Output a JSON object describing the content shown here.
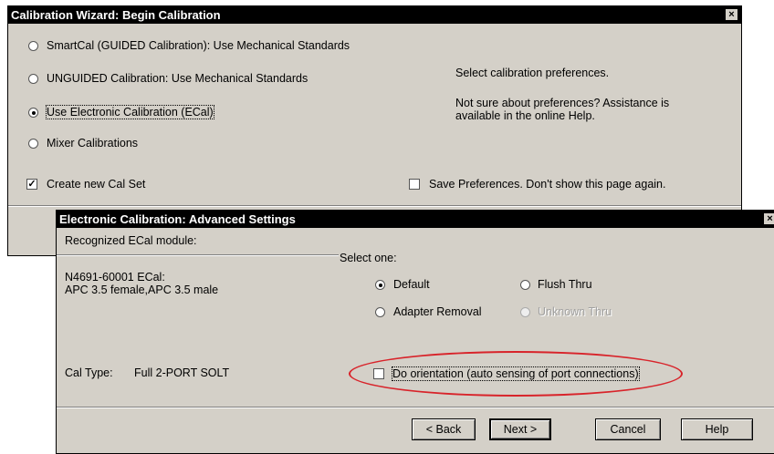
{
  "wizard": {
    "title": "Calibration Wizard: Begin Calibration",
    "close_glyph": "×",
    "options": [
      {
        "label": "SmartCal (GUIDED Calibration): Use Mechanical Standards",
        "selected": false
      },
      {
        "label": "UNGUIDED Calibration: Use Mechanical Standards",
        "selected": false
      },
      {
        "label": "Use Electronic Calibration (ECal)",
        "selected": true
      },
      {
        "label": "Mixer Calibrations",
        "selected": false
      }
    ],
    "info_text": "Select calibration preferences.",
    "help_line1": "Not sure about preferences?  Assistance is",
    "help_line2": "available in the online Help.",
    "create_cal_set": {
      "label": "Create new Cal Set",
      "checked": true
    },
    "save_prefs": {
      "label": "Save Preferences. Don't show this page again.",
      "checked": false
    }
  },
  "ecal": {
    "title": "Electronic Calibration: Advanced Settings",
    "close_glyph": "×",
    "recognized_label": "Recognized ECal module:",
    "module_line1": "N4691-60001 ECal:",
    "module_line2": "APC 3.5 female,APC 3.5 male",
    "cal_type_label": "Cal Type:",
    "cal_type_value": "Full 2-PORT SOLT",
    "select_one": "Select one:",
    "thru_options": [
      {
        "label": "Default",
        "selected": true,
        "enabled": true
      },
      {
        "label": "Flush Thru",
        "selected": false,
        "enabled": true
      },
      {
        "label": "Adapter Removal",
        "selected": false,
        "enabled": true
      },
      {
        "label": "Unknown Thru",
        "selected": false,
        "enabled": false
      }
    ],
    "orientation": {
      "label": "Do orientation (auto sensing of port connections)",
      "checked": false
    },
    "buttons": {
      "back": "< Back",
      "next": "Next >",
      "cancel": "Cancel",
      "help": "Help"
    }
  },
  "colors": {
    "dialog_bg": "#d4d0c8",
    "titlebar_bg": "#000000",
    "highlight_ellipse": "#d8232a"
  }
}
